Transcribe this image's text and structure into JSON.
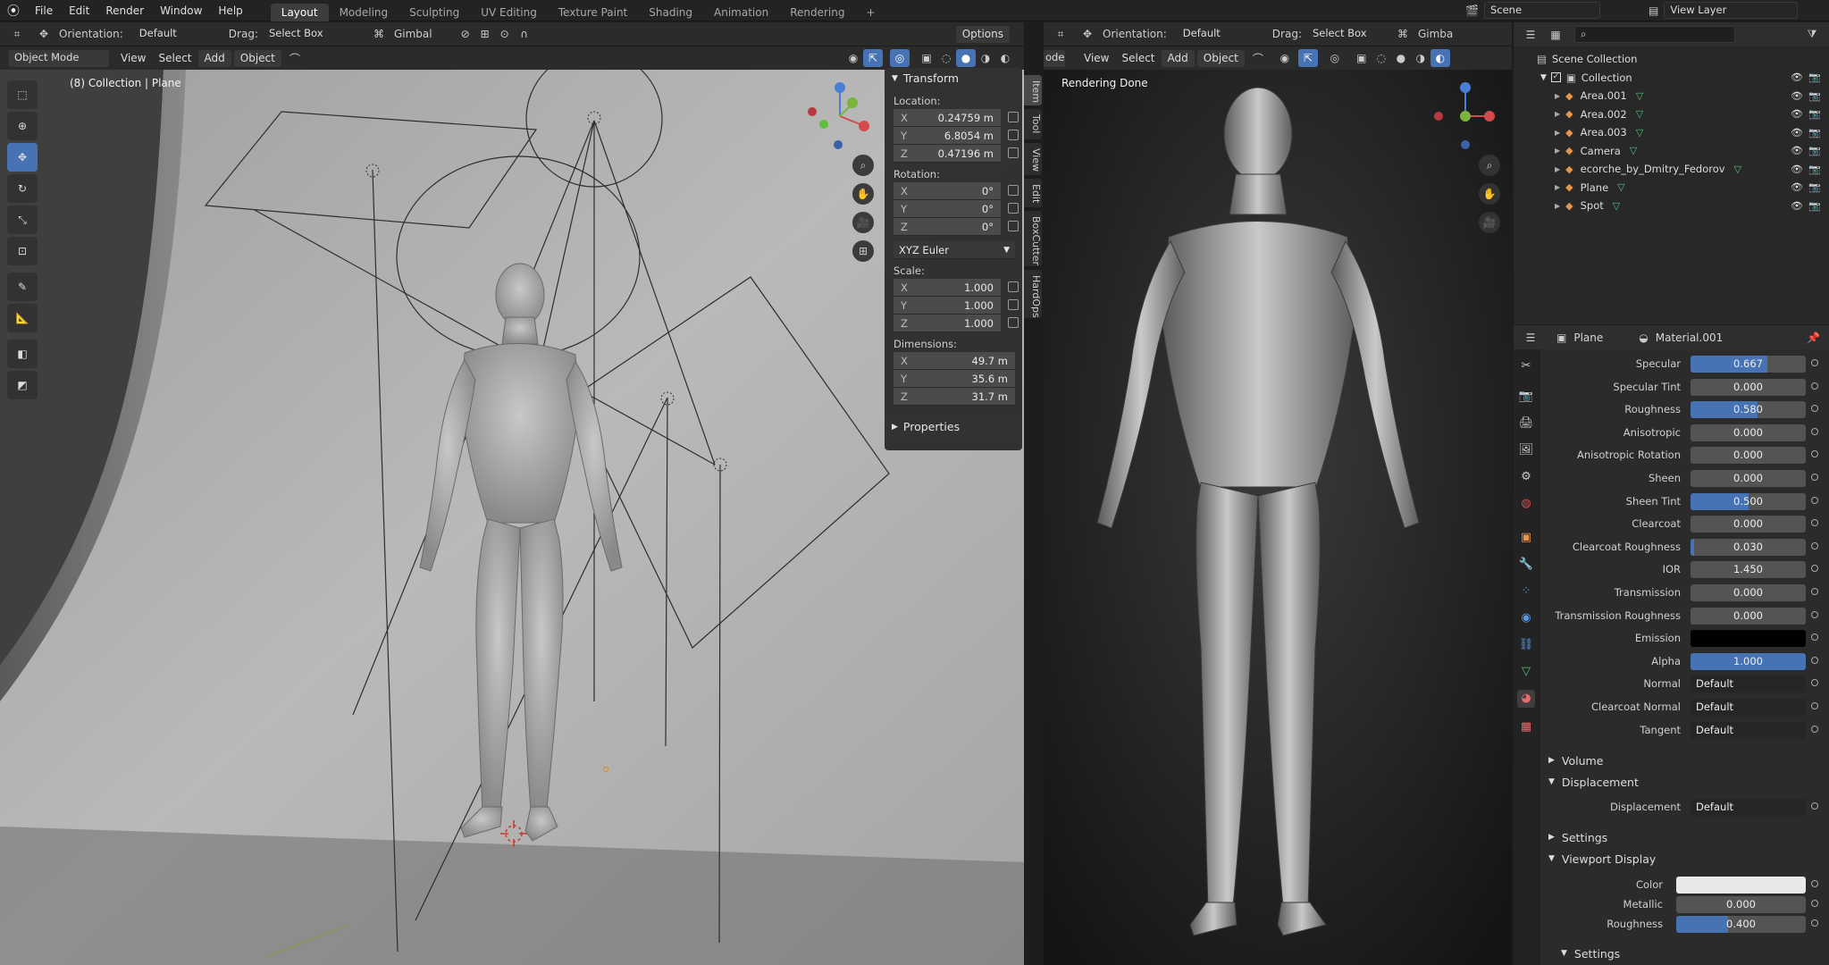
{
  "topbar": {
    "menus": [
      "File",
      "Edit",
      "Render",
      "Window",
      "Help"
    ],
    "workspaces": [
      "Layout",
      "Modeling",
      "Sculpting",
      "UV Editing",
      "Texture Paint",
      "Shading",
      "Animation",
      "Rendering"
    ],
    "active_workspace": "Layout",
    "add_workspace": "+",
    "scene_label": "Scene",
    "view_layer_label": "View Layer"
  },
  "left_view": {
    "header": {
      "orientation_label": "Orientation:",
      "orientation_value": "Default",
      "drag_label": "Drag:",
      "drag_value": "Select Box",
      "pivot_value": "Gimbal",
      "options": "Options"
    },
    "header2": {
      "mode": "Object Mode",
      "menus": [
        "View",
        "Select",
        "Add",
        "Object"
      ]
    },
    "overlay_text": "(8) Collection | Plane",
    "npanel": {
      "transform_title": "Transform",
      "location_label": "Location:",
      "location": [
        {
          "axis": "X",
          "value": "0.24759 m"
        },
        {
          "axis": "Y",
          "value": "6.8054 m"
        },
        {
          "axis": "Z",
          "value": "0.47196 m"
        }
      ],
      "rotation_label": "Rotation:",
      "rotation": [
        {
          "axis": "X",
          "value": "0°"
        },
        {
          "axis": "Y",
          "value": "0°"
        },
        {
          "axis": "Z",
          "value": "0°"
        }
      ],
      "rotation_mode": "XYZ Euler",
      "scale_label": "Scale:",
      "scale": [
        {
          "axis": "X",
          "value": "1.000"
        },
        {
          "axis": "Y",
          "value": "1.000"
        },
        {
          "axis": "Z",
          "value": "1.000"
        }
      ],
      "dimensions_label": "Dimensions:",
      "dimensions": [
        {
          "axis": "X",
          "value": "49.7 m"
        },
        {
          "axis": "Y",
          "value": "35.6 m"
        },
        {
          "axis": "Z",
          "value": "31.7 m"
        }
      ],
      "properties_title": "Properties",
      "tabs": [
        "Item",
        "Tool",
        "View",
        "Edit",
        "BoxCutter",
        "HardOps"
      ]
    }
  },
  "right_view": {
    "header": {
      "orientation_label": "Orientation:",
      "orientation_value": "Default",
      "drag_label": "Drag:",
      "drag_value": "Select Box",
      "pivot_value": "Gimba"
    },
    "header2": {
      "mode": "ode",
      "menus": [
        "View",
        "Select",
        "Add",
        "Object"
      ]
    },
    "overlay_text": "Rendering Done"
  },
  "outliner": {
    "root": "Scene Collection",
    "collection": "Collection",
    "items": [
      {
        "name": "Area.001",
        "color": "#e8944a"
      },
      {
        "name": "Area.002",
        "color": "#e8944a"
      },
      {
        "name": "Area.003",
        "color": "#e8944a"
      },
      {
        "name": "Camera",
        "color": "#e8944a"
      },
      {
        "name": "ecorche_by_Dmitry_Fedorov",
        "color": "#e8944a"
      },
      {
        "name": "Plane",
        "color": "#e8944a"
      },
      {
        "name": "Spot",
        "color": "#e8944a"
      }
    ]
  },
  "properties": {
    "object_name": "Plane",
    "material_name": "Material.001",
    "rows": [
      {
        "label": "Specular",
        "value": "0.667",
        "fill": 0.667
      },
      {
        "label": "Specular Tint",
        "value": "0.000",
        "fill": 0
      },
      {
        "label": "Roughness",
        "value": "0.580",
        "fill": 0.58
      },
      {
        "label": "Anisotropic",
        "value": "0.000",
        "fill": 0
      },
      {
        "label": "Anisotropic Rotation",
        "value": "0.000",
        "fill": 0
      },
      {
        "label": "Sheen",
        "value": "0.000",
        "fill": 0
      },
      {
        "label": "Sheen Tint",
        "value": "0.500",
        "fill": 0.5
      },
      {
        "label": "Clearcoat",
        "value": "0.000",
        "fill": 0
      },
      {
        "label": "Clearcoat Roughness",
        "value": "0.030",
        "fill": 0.03
      },
      {
        "label": "IOR",
        "value": "1.450",
        "fill": 0
      },
      {
        "label": "Transmission",
        "value": "0.000",
        "fill": 0
      },
      {
        "label": "Transmission Roughness",
        "value": "0.000",
        "fill": 0
      },
      {
        "label": "Emission",
        "value": "",
        "fill": 0,
        "swatch": "#000000"
      },
      {
        "label": "Alpha",
        "value": "1.000",
        "fill": 1
      },
      {
        "label": "Normal",
        "value": "Default",
        "fill": 0,
        "link": true
      },
      {
        "label": "Clearcoat Normal",
        "value": "Default",
        "fill": 0,
        "link": true
      },
      {
        "label": "Tangent",
        "value": "Default",
        "fill": 0,
        "link": true
      }
    ],
    "sections": {
      "volume": "Volume",
      "displacement": "Displacement",
      "displacement_label": "Displacement",
      "displacement_value": "Default",
      "settings": "Settings",
      "viewport_display": "Viewport Display",
      "color_label": "Color",
      "color_swatch": "#e8e8e8",
      "metallic_label": "Metallic",
      "metallic_value": "0.000",
      "metallic_fill": 0,
      "roughness_label": "Roughness",
      "roughness_value": "0.400",
      "roughness_fill": 0.4,
      "settings2": "Settings"
    }
  }
}
